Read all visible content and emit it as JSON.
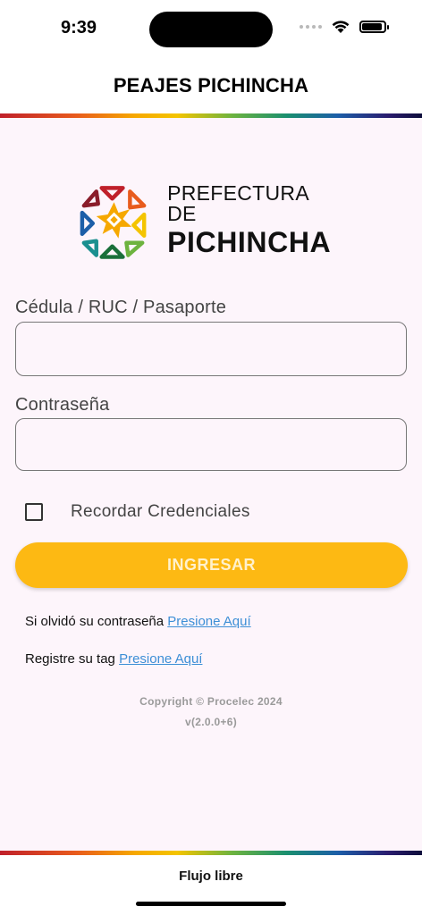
{
  "status_bar": {
    "time": "9:39"
  },
  "header": {
    "title": "PEAJES PICHINCHA"
  },
  "logo": {
    "line1": "PREFECTURA DE",
    "line2": "PICHINCHA"
  },
  "form": {
    "id_label": "Cédula / RUC / Pasaporte",
    "id_value": "",
    "password_label": "Contraseña",
    "password_value": "",
    "remember_label": "Recordar Credenciales",
    "remember_checked": false,
    "submit_label": "INGRESAR"
  },
  "links": {
    "forgot_text": "Si olvidó su contraseña ",
    "forgot_link": "Presione Aquí",
    "register_text": "Registre su tag ",
    "register_link": "Presione Aquí"
  },
  "copyright": {
    "line1": "Copyright © Procelec 2024",
    "version": "v(2.0.0+6)"
  },
  "footer": {
    "label": "Flujo libre"
  },
  "colors": {
    "accent": "#fdb913",
    "link": "#3d8fd6",
    "background": "#fdf5fb"
  }
}
